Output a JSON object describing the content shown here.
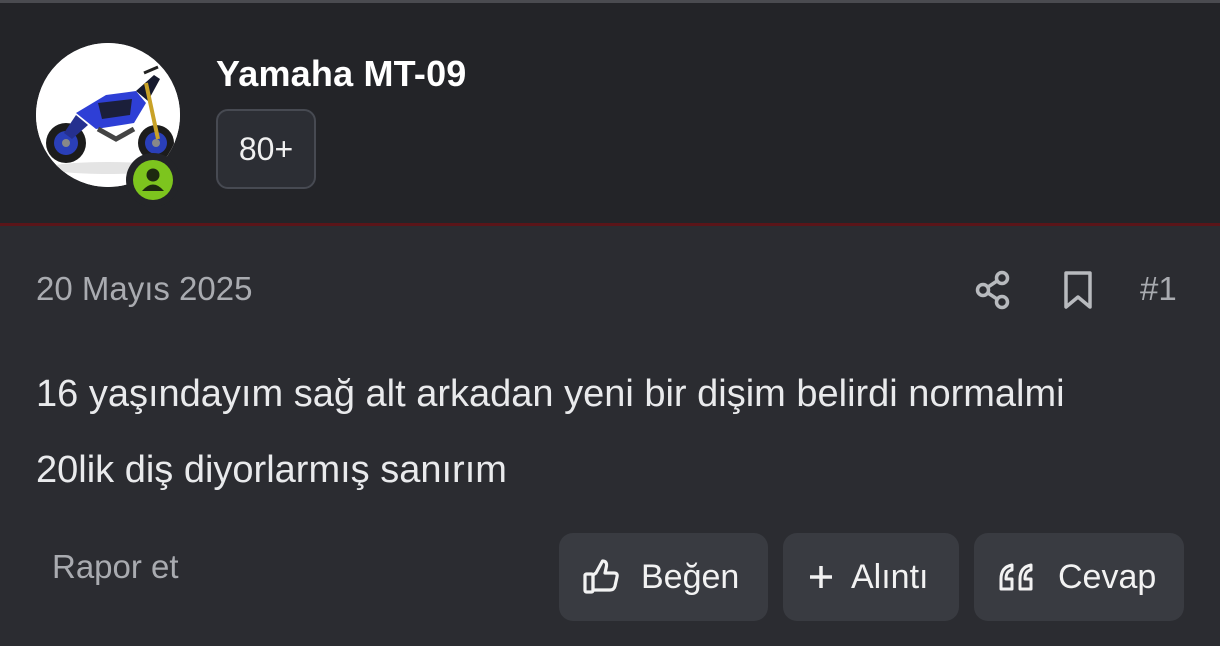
{
  "post": {
    "author": "Yamaha MT-09",
    "author_badge": "80+",
    "date": "20 Mayıs 2025",
    "number": "#1",
    "content_line1": "16 yaşındayım sağ alt arkadan yeni bir dişim belirdi normalmi",
    "content_line2": "20lik diş diyorlarmış sanırım"
  },
  "actions": {
    "report": "Rapor et",
    "like": "Beğen",
    "quote": "Alıntı",
    "reply": "Cevap"
  },
  "icons": {
    "share": "share-icon",
    "bookmark": "bookmark-icon",
    "like": "thumbs-up-icon",
    "quote": "plus-icon",
    "reply": "quote-marks-icon",
    "online": "user-online-icon"
  },
  "colors": {
    "background": "#2b2c31",
    "header": "#232428",
    "accent_border": "#5a1519",
    "online": "#7dc51e",
    "button": "#393b41"
  }
}
